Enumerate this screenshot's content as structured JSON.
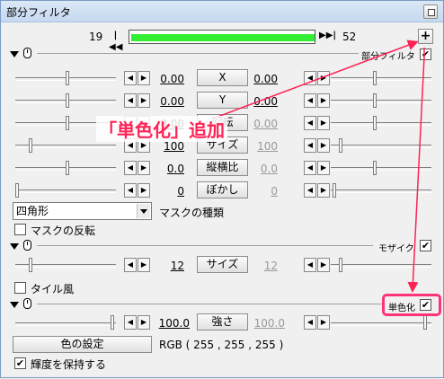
{
  "window": {
    "title": "部分フィルタ"
  },
  "timeline": {
    "start_frame": "19",
    "end_frame": "52",
    "range_fraction": 1.0
  },
  "section_partial": {
    "label": "部分フィルタ",
    "checked": true,
    "rows": [
      {
        "value": "0.00",
        "button": "X",
        "value2": "0.00",
        "enabled": true
      },
      {
        "value": "0.00",
        "button": "Y",
        "value2": "0.00",
        "enabled": true
      },
      {
        "value": "0.00",
        "button": "回転",
        "value2": "0.00",
        "enabled": false
      },
      {
        "value": "100",
        "button": "サイズ",
        "value2": "100",
        "enabled": false
      },
      {
        "value": "0.0",
        "button": "縦横比",
        "value2": "0.0",
        "enabled": false
      },
      {
        "value": "0",
        "button": "ぼかし",
        "value2": "0",
        "enabled": false
      }
    ],
    "mask_type_value": "四角形",
    "mask_type_label": "マスクの種類",
    "mask_invert_label": "マスクの反転",
    "mask_invert_checked": false
  },
  "section_mosaic": {
    "label": "モザイク",
    "checked": true,
    "row": {
      "value": "12",
      "button": "サイズ",
      "value2": "12"
    },
    "tile_label": "タイル風",
    "tile_checked": false
  },
  "section_mono": {
    "label": "単色化",
    "checked": true,
    "row": {
      "value": "100.0",
      "button": "強さ",
      "value2": "100.0"
    },
    "color_button": "色の設定",
    "rgb_text": "RGB ( 255 , 255 , 255 )",
    "keep_luma_label": "輝度を保持する",
    "keep_luma_checked": true
  },
  "annotation": {
    "text": "「単色化」追加",
    "color": "#ff2255"
  },
  "colors": {
    "range_bar": "#33ee33",
    "highlight": "#ff3377"
  },
  "icons": {
    "prev": "double-left-arrow-icon",
    "next": "double-right-arrow-icon",
    "add": "plus-icon",
    "collapse": "triangle-down-icon",
    "mouse": "mouse-icon"
  }
}
